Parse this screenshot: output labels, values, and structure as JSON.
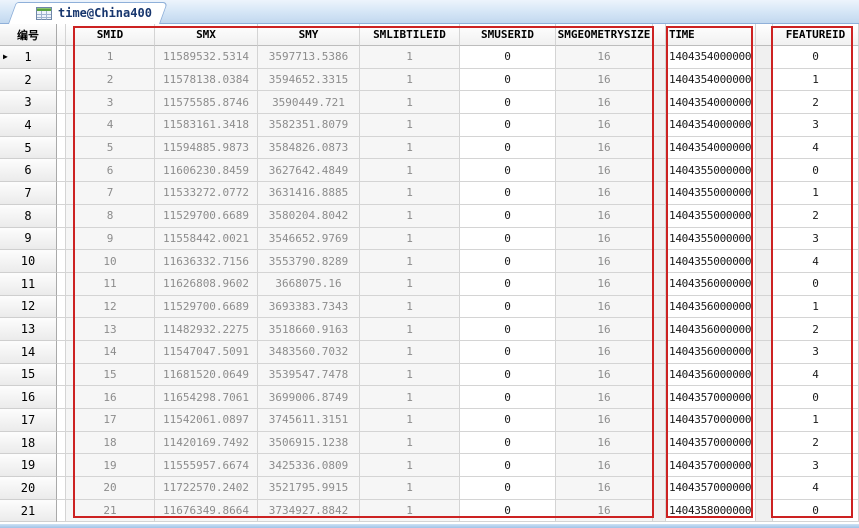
{
  "tab": {
    "label": "time@China400",
    "icon": "table-grid-icon"
  },
  "colors": {
    "annotation": "#cc2222",
    "window_edge": "#9fc3e7",
    "tab_text": "#17366e",
    "readonly_text": "#8c8c8c"
  },
  "table": {
    "column_labels": {
      "n": "编号",
      "smid": "SMID",
      "smx": "SMX",
      "smy": "SMY",
      "smlibtileid": "SMLIBTILEID",
      "smuserid": "SMUSERID",
      "smgeometrysize": "SMGEOMETRYSIZE",
      "time": "TIME",
      "featureid": "FEATUREID"
    },
    "current_row": 1,
    "rows": [
      {
        "n": 1,
        "smid": 1,
        "smx": "11589532.5314",
        "smy": "3597713.5386",
        "smlibtileid": 1,
        "smuserid": 0,
        "smgeometrysize": 16,
        "time": "1404354000000",
        "featureid": 0
      },
      {
        "n": 2,
        "smid": 2,
        "smx": "11578138.0384",
        "smy": "3594652.3315",
        "smlibtileid": 1,
        "smuserid": 0,
        "smgeometrysize": 16,
        "time": "1404354000000",
        "featureid": 1
      },
      {
        "n": 3,
        "smid": 3,
        "smx": "11575585.8746",
        "smy": "3590449.721",
        "smlibtileid": 1,
        "smuserid": 0,
        "smgeometrysize": 16,
        "time": "1404354000000",
        "featureid": 2
      },
      {
        "n": 4,
        "smid": 4,
        "smx": "11583161.3418",
        "smy": "3582351.8079",
        "smlibtileid": 1,
        "smuserid": 0,
        "smgeometrysize": 16,
        "time": "1404354000000",
        "featureid": 3
      },
      {
        "n": 5,
        "smid": 5,
        "smx": "11594885.9873",
        "smy": "3584826.0873",
        "smlibtileid": 1,
        "smuserid": 0,
        "smgeometrysize": 16,
        "time": "1404354000000",
        "featureid": 4
      },
      {
        "n": 6,
        "smid": 6,
        "smx": "11606230.8459",
        "smy": "3627642.4849",
        "smlibtileid": 1,
        "smuserid": 0,
        "smgeometrysize": 16,
        "time": "1404355000000",
        "featureid": 0
      },
      {
        "n": 7,
        "smid": 7,
        "smx": "11533272.0772",
        "smy": "3631416.8885",
        "smlibtileid": 1,
        "smuserid": 0,
        "smgeometrysize": 16,
        "time": "1404355000000",
        "featureid": 1
      },
      {
        "n": 8,
        "smid": 8,
        "smx": "11529700.6689",
        "smy": "3580204.8042",
        "smlibtileid": 1,
        "smuserid": 0,
        "smgeometrysize": 16,
        "time": "1404355000000",
        "featureid": 2
      },
      {
        "n": 9,
        "smid": 9,
        "smx": "11558442.0021",
        "smy": "3546652.9769",
        "smlibtileid": 1,
        "smuserid": 0,
        "smgeometrysize": 16,
        "time": "1404355000000",
        "featureid": 3
      },
      {
        "n": 10,
        "smid": 10,
        "smx": "11636332.7156",
        "smy": "3553790.8289",
        "smlibtileid": 1,
        "smuserid": 0,
        "smgeometrysize": 16,
        "time": "1404355000000",
        "featureid": 4
      },
      {
        "n": 11,
        "smid": 11,
        "smx": "11626808.9602",
        "smy": "3668075.16",
        "smlibtileid": 1,
        "smuserid": 0,
        "smgeometrysize": 16,
        "time": "1404356000000",
        "featureid": 0
      },
      {
        "n": 12,
        "smid": 12,
        "smx": "11529700.6689",
        "smy": "3693383.7343",
        "smlibtileid": 1,
        "smuserid": 0,
        "smgeometrysize": 16,
        "time": "1404356000000",
        "featureid": 1
      },
      {
        "n": 13,
        "smid": 13,
        "smx": "11482932.2275",
        "smy": "3518660.9163",
        "smlibtileid": 1,
        "smuserid": 0,
        "smgeometrysize": 16,
        "time": "1404356000000",
        "featureid": 2
      },
      {
        "n": 14,
        "smid": 14,
        "smx": "11547047.5091",
        "smy": "3483560.7032",
        "smlibtileid": 1,
        "smuserid": 0,
        "smgeometrysize": 16,
        "time": "1404356000000",
        "featureid": 3
      },
      {
        "n": 15,
        "smid": 15,
        "smx": "11681520.0649",
        "smy": "3539547.7478",
        "smlibtileid": 1,
        "smuserid": 0,
        "smgeometrysize": 16,
        "time": "1404356000000",
        "featureid": 4
      },
      {
        "n": 16,
        "smid": 16,
        "smx": "11654298.7061",
        "smy": "3699006.8749",
        "smlibtileid": 1,
        "smuserid": 0,
        "smgeometrysize": 16,
        "time": "1404357000000",
        "featureid": 0
      },
      {
        "n": 17,
        "smid": 17,
        "smx": "11542061.0897",
        "smy": "3745611.3151",
        "smlibtileid": 1,
        "smuserid": 0,
        "smgeometrysize": 16,
        "time": "1404357000000",
        "featureid": 1
      },
      {
        "n": 18,
        "smid": 18,
        "smx": "11420169.7492",
        "smy": "3506915.1238",
        "smlibtileid": 1,
        "smuserid": 0,
        "smgeometrysize": 16,
        "time": "1404357000000",
        "featureid": 2
      },
      {
        "n": 19,
        "smid": 19,
        "smx": "11555957.6674",
        "smy": "3425336.0809",
        "smlibtileid": 1,
        "smuserid": 0,
        "smgeometrysize": 16,
        "time": "1404357000000",
        "featureid": 3
      },
      {
        "n": 20,
        "smid": 20,
        "smx": "11722570.2402",
        "smy": "3521795.9915",
        "smlibtileid": 1,
        "smuserid": 0,
        "smgeometrysize": 16,
        "time": "1404357000000",
        "featureid": 4
      },
      {
        "n": 21,
        "smid": 21,
        "smx": "11676349.8664",
        "smy": "3734927.8842",
        "smlibtileid": 1,
        "smuserid": 0,
        "smgeometrysize": 16,
        "time": "1404358000000",
        "featureid": 0
      }
    ]
  }
}
